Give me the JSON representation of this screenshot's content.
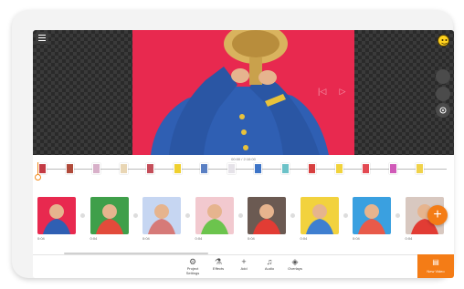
{
  "preview": {
    "timecode": "00:00 / 2:10:00",
    "controls": {
      "prev": "|◁",
      "play": "▷",
      "next": "▷|"
    }
  },
  "colors": {
    "accent": "#f47c16",
    "video_bg": "#e8294f",
    "jacket": "#2f5fb3"
  },
  "strip": {
    "thumb_colors": [
      "#c33a44",
      "#b04a3a",
      "#d8b0c9",
      "#e9d6b4",
      "#c44e5a",
      "#efd02f",
      "#5a7fc3",
      "#e5e2e8",
      "#3d74c7",
      "#6cc2c8",
      "#d73f3f",
      "#f1d33c",
      "#e34a52",
      "#d05ab8",
      "#f0d24a"
    ]
  },
  "clips": [
    {
      "duration": "0:04",
      "bg": "#e8294f",
      "fg": "#2f5fb3"
    },
    {
      "duration": "0:04",
      "bg": "#3f9f4a",
      "fg": "#e24b3b"
    },
    {
      "duration": "0:04",
      "bg": "#c6d6f2",
      "fg": "#d67a78"
    },
    {
      "duration": "0:04",
      "bg": "#f2c9cf",
      "fg": "#6cc44d"
    },
    {
      "duration": "0:04",
      "bg": "#6b5a52",
      "fg": "#e23c34"
    },
    {
      "duration": "0:04",
      "bg": "#f2d23e",
      "fg": "#3f7fd0"
    },
    {
      "duration": "0:04",
      "bg": "#3aa0e0",
      "fg": "#e85a4a"
    },
    {
      "duration": "0:04",
      "bg": "#d8c8c0",
      "fg": "#e23c34"
    }
  ],
  "toolbar": {
    "items": [
      {
        "label": "Project\nSettings",
        "icon": "⚙"
      },
      {
        "label": "Effects",
        "icon": "⚗"
      },
      {
        "label": "Add",
        "icon": "+"
      },
      {
        "label": "Audio",
        "icon": "♫"
      },
      {
        "label": "Overlays",
        "icon": "◈"
      }
    ],
    "new_video": {
      "label": "New Video",
      "icon": "▤"
    }
  },
  "add_button": {
    "label": "+"
  }
}
